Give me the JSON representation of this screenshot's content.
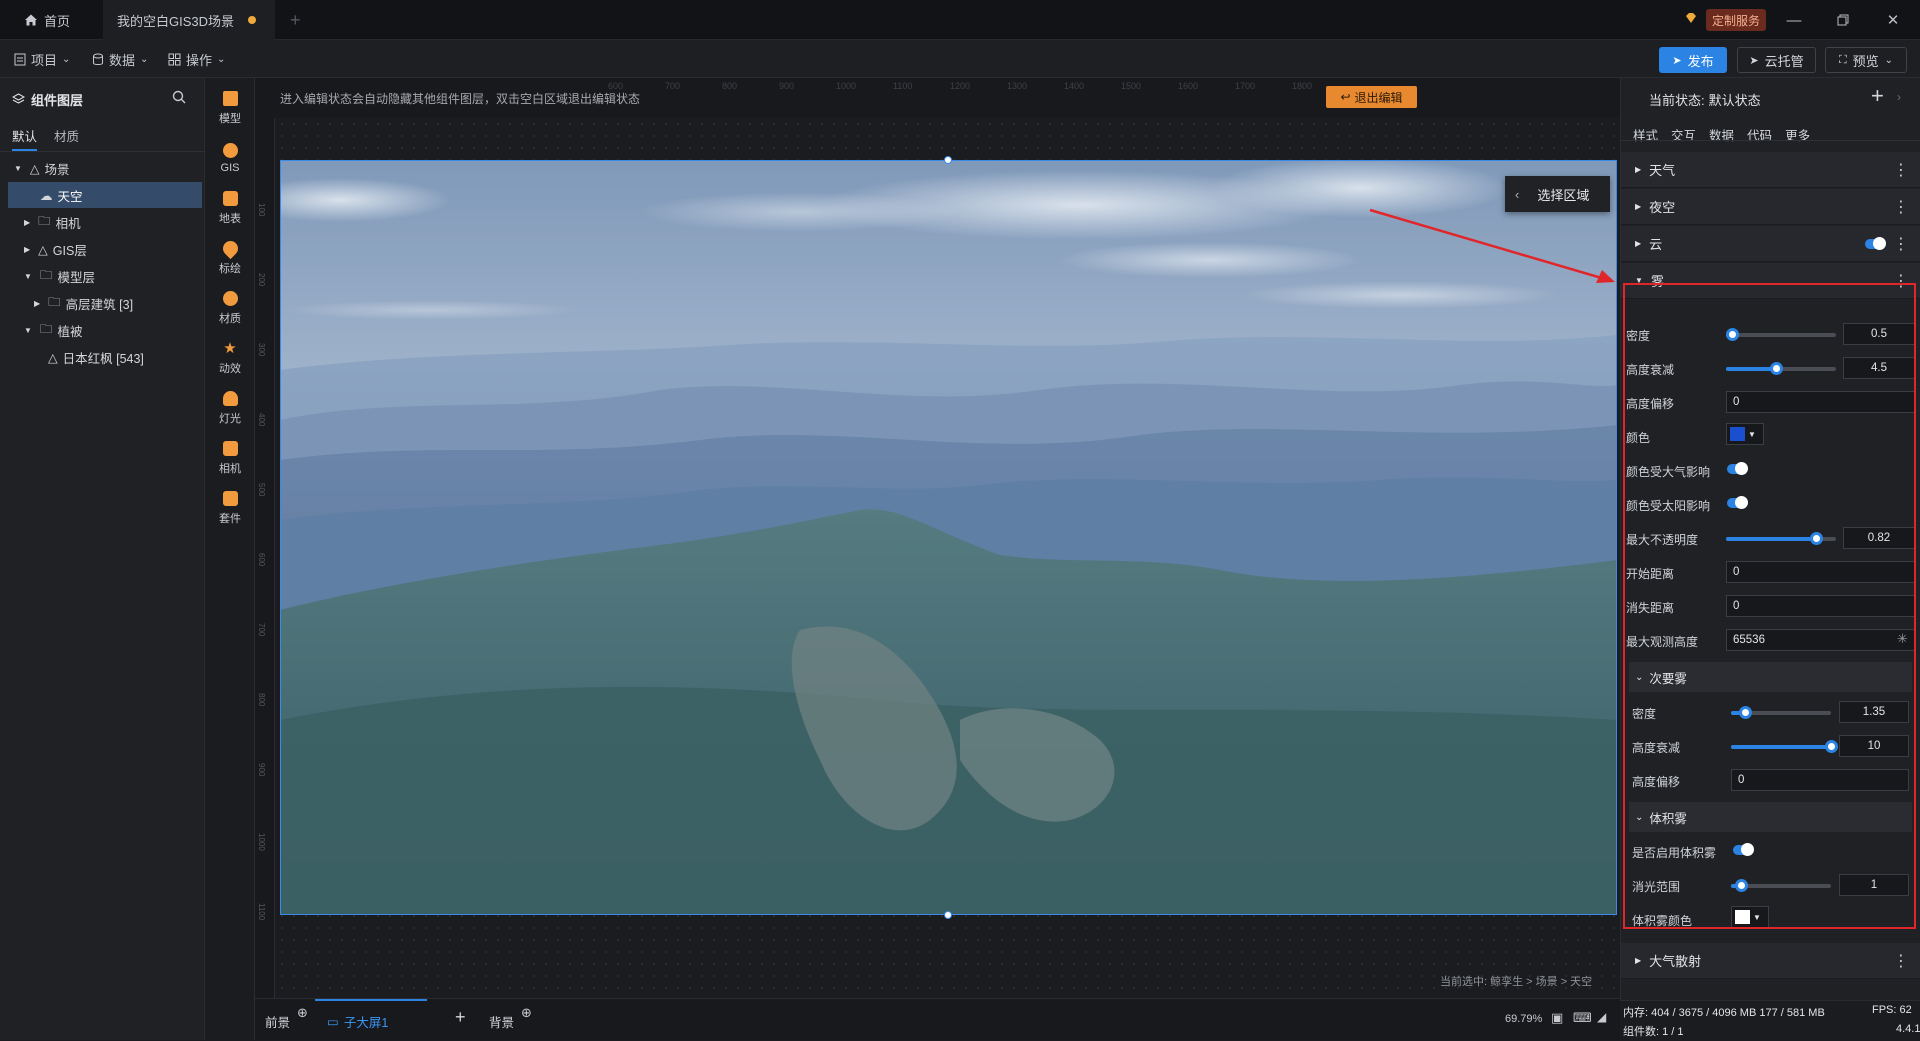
{
  "titlebar": {
    "home_tab": "首页",
    "doc_tab": "我的空白GIS3D场景",
    "custom_service": "定制服务"
  },
  "menubar": {
    "project": "项目",
    "data": "数据",
    "ops": "操作",
    "publish": "发布",
    "cloud": "云托管",
    "preview": "预览"
  },
  "left": {
    "title": "组件图层",
    "tabs": [
      "默认",
      "材质"
    ],
    "tree": [
      {
        "label": "场景"
      },
      {
        "label": "天空"
      },
      {
        "label": "相机"
      },
      {
        "label": "GIS层"
      },
      {
        "label": "模型层"
      },
      {
        "label": "高层建筑 [3]"
      },
      {
        "label": "植被"
      },
      {
        "label": "日本红枫 [543]"
      }
    ]
  },
  "rail": [
    "模型",
    "GIS",
    "地表",
    "标绘",
    "材质",
    "动效",
    "灯光",
    "相机",
    "套件"
  ],
  "canvas": {
    "hint": "进入编辑状态会自动隐藏其他组件图层，双击空白区域退出编辑状态",
    "exit_edit": "退出编辑",
    "select_region": "选择区域",
    "ruler_top": [
      "600",
      "700",
      "800",
      "900",
      "1000",
      "1100",
      "1200",
      "1300",
      "1400",
      "1500",
      "1600",
      "1700",
      "1800"
    ],
    "ruler_left": [
      "100",
      "200",
      "300",
      "400",
      "500",
      "600",
      "700",
      "800",
      "900",
      "1000",
      "1100"
    ],
    "breadcrumb": "当前选中: 鲸孪生 > 场景 > 天空"
  },
  "right": {
    "state_label": "当前状态:",
    "state_value": "默认状态",
    "tabs": [
      "样式",
      "交互",
      "数据",
      "代码",
      "更多"
    ],
    "sections": {
      "weather": "天气",
      "nightsky": "夜空",
      "cloud": "云",
      "fog": "雾",
      "atmos": "大气散射"
    },
    "fog": {
      "density": {
        "label": "密度",
        "value": "0.5",
        "fraction": 0.05
      },
      "height_falloff": {
        "label": "高度衰减",
        "value": "4.5",
        "fraction": 0.45
      },
      "height_offset": {
        "label": "高度偏移",
        "value": "0"
      },
      "color": {
        "label": "颜色",
        "hex": "#1a4fd0"
      },
      "color_atmos": {
        "label": "颜色受大气影响"
      },
      "color_sun": {
        "label": "颜色受太阳影响"
      },
      "max_opacity": {
        "label": "最大不透明度",
        "value": "0.82",
        "fraction": 0.82
      },
      "start_distance": {
        "label": "开始距离",
        "value": "0"
      },
      "cutoff_distance": {
        "label": "消失距离",
        "value": "0"
      },
      "max_view_height": {
        "label": "最大观测高度",
        "value": "65536"
      }
    },
    "secondary_fog": {
      "title": "次要雾",
      "density": {
        "label": "密度",
        "value": "1.35",
        "fraction": 0.14
      },
      "height_falloff": {
        "label": "高度衰减",
        "value": "10",
        "fraction": 1.0
      },
      "height_offset": {
        "label": "高度偏移",
        "value": "0"
      }
    },
    "volumetric": {
      "title": "体积雾",
      "enable": {
        "label": "是否启用体积雾"
      },
      "extinction": {
        "label": "消光范围",
        "value": "1",
        "fraction": 0.1
      },
      "color": {
        "label": "体积雾颜色",
        "hex": "#ffffff"
      }
    }
  },
  "bottom": {
    "foreground": "前景",
    "screen_tab": "子大屏1",
    "background": "背景",
    "zoom": "69.79%"
  },
  "status": {
    "memory": "内存: 404 / 3675 / 4096 MB  177 / 581 MB",
    "fps": "FPS: 62",
    "components": "组件数: 1 / 1",
    "version": "4.4.1"
  }
}
